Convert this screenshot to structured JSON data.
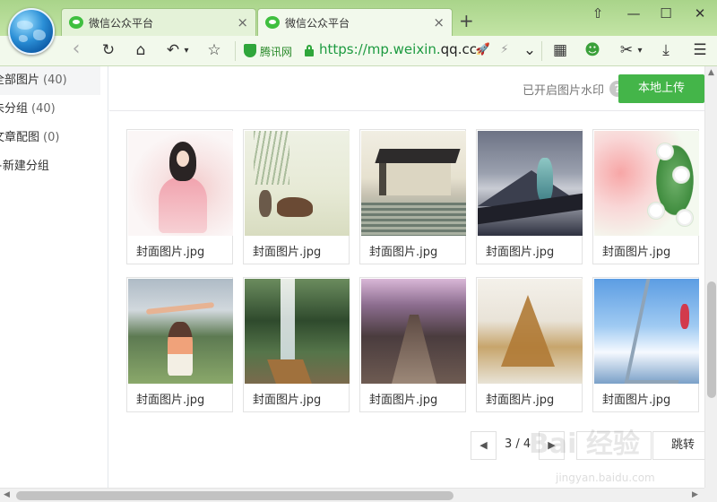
{
  "browser": {
    "tabs": [
      {
        "label": "微信公众平台",
        "close": "×"
      },
      {
        "label": "微信公众平台",
        "close": "×"
      }
    ],
    "new_tab": "+",
    "window_buttons": {
      "skin": "⇧",
      "minimize": "—",
      "maximize": "☐",
      "close": "✕"
    },
    "toolbar": {
      "back": "‹",
      "refresh": "↻",
      "home": "⌂",
      "undo": "↶",
      "undo_menu": "▾",
      "favorite": "☆",
      "verify_label": "腾讯网",
      "url_scheme": "https://mp.weixin.",
      "url_host": "qq.cc",
      "rocket": "🚀",
      "bolt": "⚡",
      "dropdown": "⌄",
      "apps": "▦",
      "wechat": "☻",
      "cut": "✂",
      "cut_menu": "▾",
      "download": "⤓",
      "menu": "☰"
    },
    "accent": "#44b549",
    "chrome_color": "#c3e4a5"
  },
  "sidebar": {
    "items": [
      {
        "label": "全部图片",
        "count": "(40)"
      },
      {
        "label": "未分组",
        "count": "(40)"
      },
      {
        "label": "文章配图",
        "count": "(0)"
      },
      {
        "label": "+新建分组",
        "count": ""
      }
    ]
  },
  "header": {
    "watermark_label": "已开启图片水印",
    "help": "?",
    "upload_button": "本地上传"
  },
  "images": [
    {
      "caption": "封面图片.jpg"
    },
    {
      "caption": "封面图片.jpg"
    },
    {
      "caption": "封面图片.jpg"
    },
    {
      "caption": "封面图片.jpg"
    },
    {
      "caption": "封面图片.jpg"
    },
    {
      "caption": "封面图片.jpg"
    },
    {
      "caption": "封面图片.jpg"
    },
    {
      "caption": "封面图片.jpg"
    },
    {
      "caption": "封面图片.jpg"
    },
    {
      "caption": "封面图片.jpg"
    }
  ],
  "pagination": {
    "prev": "◀",
    "next": "▶",
    "info": "3 / 4",
    "jump_button": "跳转"
  },
  "watermark": {
    "main": "Bai 经验",
    "sub": "jingyan.baidu.com"
  },
  "scroll": {
    "up": "▲",
    "down": "▼",
    "left": "◀",
    "right": "▶"
  }
}
